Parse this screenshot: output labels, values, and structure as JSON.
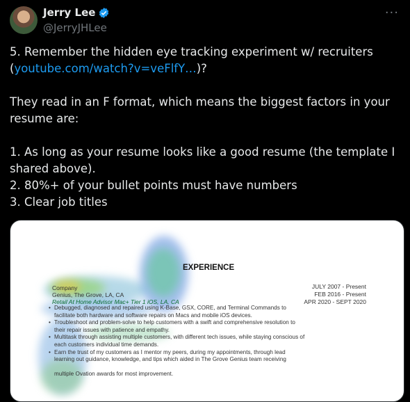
{
  "author": {
    "name": "Jerry Lee",
    "handle": "@JerryJHLee"
  },
  "more_label": "···",
  "tweet": {
    "line1": "5. Remember the hidden eye tracking  experiment w/ recruiters",
    "paren_open": "(",
    "link_text": "youtube.com/watch?v=veFlfY…",
    "paren_close": ")?",
    "para2": "They read in an F format, which means the biggest factors in your resume are:",
    "item1": "1. As long as your resume looks like a good resume (the template I shared above).",
    "item2": "2. 80%+ of your bullet points must have numbers",
    "item3": "3. Clear job titles"
  },
  "resume": {
    "heading": "EXPERIENCE",
    "company": "Company",
    "employer": "Genius, The Grove, LA, CA",
    "role": "Retail At Home Advisor Mac+ Tier 1 iOS, LA, CA",
    "date1": "JULY 2007 - Present",
    "date2": "FEB 2016 - Present",
    "date3": "APR 2020 - SEPT 2020",
    "b1a": "Debugged, diagnosed and repaired using K-Base, GSX, CORE, and Terminal Commands to",
    "b1b": "facilitate both hardware and software repairs on Macs and mobile iOS devices.",
    "b2a": "Troubleshoot and problem-solve to help customers with a swift and comprehensive resolution to",
    "b2b": "their repair issues with patience and empathy.",
    "b3a": "Multitask through assisting multiple customers, with different tech issues, while staying conscious of",
    "b3b": "each customers individual time demands.",
    "b4a": "Earn the trust of my customers as I mentor my peers, during my appointments, through lead",
    "b4b": "learning out guidance, knowledge, and tips which aided in The Grove Genius team receiving",
    "b4c": "multiple Ovation awards for most improvement."
  },
  "colors": {
    "link": "#1d9bf0",
    "verified": "#1d9bf0",
    "muted": "#71767b"
  },
  "icons": [
    "verified-badge-icon",
    "more-icon"
  ]
}
